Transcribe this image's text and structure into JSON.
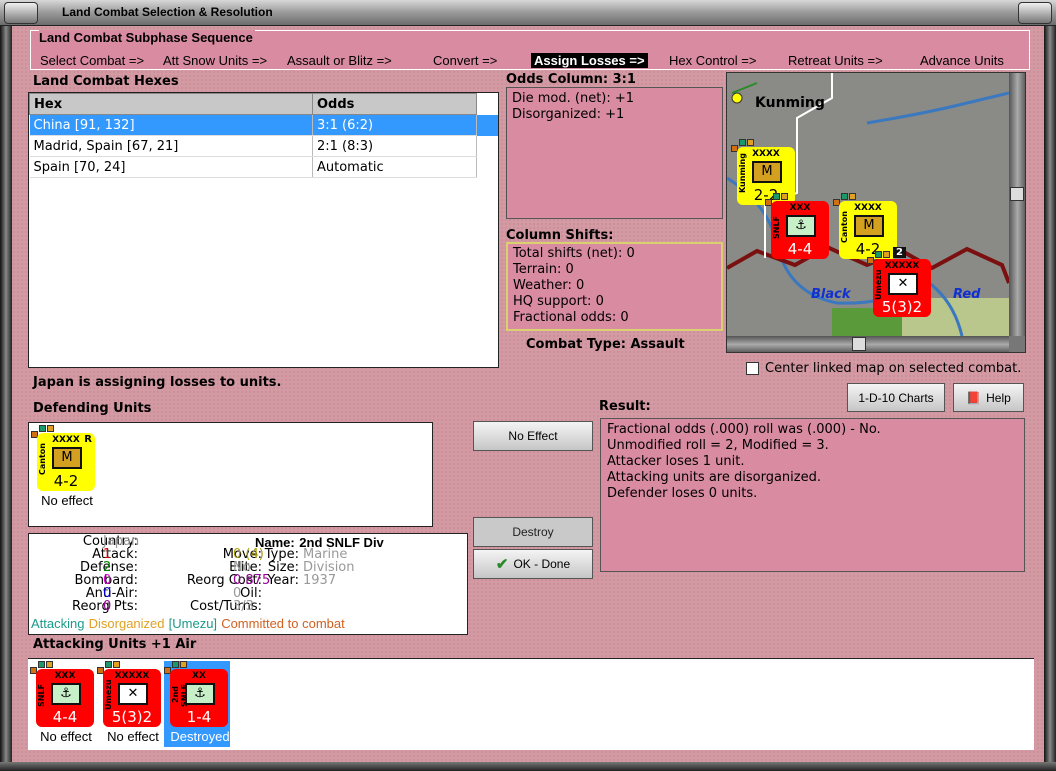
{
  "window": {
    "title": "Land Combat Selection & Resolution"
  },
  "sequence": {
    "title": "Land Combat Subphase Sequence",
    "steps": [
      "Select Combat =>",
      "Att Snow Units =>",
      "Assault or Blitz =>",
      "Convert =>",
      "Assign Losses =>",
      "Hex Control =>",
      "Retreat Units =>",
      "Advance Units"
    ],
    "active_index": 4
  },
  "hexes": {
    "title": "Land Combat Hexes",
    "columns": [
      "Hex",
      "Odds"
    ],
    "rows": [
      [
        "China [91, 132]",
        "3:1 (6:2)"
      ],
      [
        "Madrid, Spain [67, 21]",
        "2:1 (8:3)"
      ],
      [
        "Spain [70, 24]",
        "Automatic"
      ]
    ],
    "selected_index": 0
  },
  "odds": {
    "title": "Odds Column: 3:1",
    "lines": [
      "Die mod. (net): +1",
      "Disorganized: +1"
    ]
  },
  "shifts": {
    "title": "Column Shifts:",
    "lines": [
      "Total shifts (net): 0",
      "Terrain: 0",
      "Weather: 0",
      "HQ support: 0",
      "Fractional odds: 0"
    ]
  },
  "combat_type": "Combat Type:  Assault",
  "map": {
    "labels": {
      "city": "Kunming",
      "river1": "Black",
      "river2": "Red"
    },
    "units": [
      {
        "name": "Kunming",
        "size": "XXXX",
        "sym": "M",
        "str": "2-2"
      },
      {
        "name": "SNLF",
        "size": "XXX",
        "sym": "⚓",
        "str": "4-4"
      },
      {
        "name": "Canton",
        "size": "XXXX",
        "sym": "M",
        "str": "4-2"
      },
      {
        "name": "Umezu",
        "size": "XXXXX",
        "sym": "✕",
        "str": "5(3)2"
      }
    ],
    "stack_count": "2",
    "h_scroll": 0.46,
    "v_scroll": 0.45
  },
  "center_checkbox": {
    "label": "Center linked map on selected combat.",
    "checked": false
  },
  "buttons": {
    "charts": "1-D-10 Charts",
    "help": "Help",
    "no_effect": "No Effect",
    "destroy": "Destroy",
    "ok": "OK - Done"
  },
  "status": "Japan is assigning losses to units.",
  "defending": {
    "title": "Defending Units",
    "units": [
      {
        "name": "Canton",
        "size": "XXXX",
        "sym": "M",
        "str": "4-2",
        "flag": "R",
        "status": "No effect"
      }
    ]
  },
  "result": {
    "title": "Result:",
    "lines": [
      "Fractional odds (.000) roll was (.000)  - No.",
      "Unmodified roll = 2, Modified = 3.",
      "Attacker loses 1 unit.",
      "Attacking units are disorganized.",
      "Defender loses 0 units."
    ]
  },
  "info": {
    "country_l": "Country:",
    "country": "Japan",
    "attack_l": "Attack:",
    "attack": "1",
    "defense_l": "Defense:",
    "defense": "2",
    "bombard_l": "Bombard:",
    "bombard": "0",
    "aa_l": "Anti-Air:",
    "aa": "0",
    "reorgpts_l": "Reorg Pts:",
    "reorgpts": "0",
    "name_l": "Name:",
    "name": "2nd SNLF Div",
    "move_l": "Move:",
    "move": "0 (4)",
    "elite_l": "Elite:",
    "elite": "No",
    "reorgcost_l": "Reorg Cost:",
    "reorgcost": "0.875",
    "oil_l": "Oil:",
    "oil": "0",
    "cost_l": "Cost/Turns:",
    "cost": "3/3",
    "type_l": "Type:",
    "type": "Marine",
    "size_l": "Size:",
    "size": "Division",
    "year_l": "Year:",
    "year": "1937",
    "flags": [
      "Attacking",
      "Disorganized",
      "[Umezu]",
      "Committed to combat"
    ]
  },
  "attacking": {
    "title": "Attacking Units +1 Air",
    "units": [
      {
        "name": "SNLF",
        "size": "XXX",
        "sym": "⚓",
        "str": "4-4",
        "status": "No effect"
      },
      {
        "name": "Umezu",
        "size": "XXXXX",
        "sym": "✕",
        "str": "5(3)2",
        "status": "No effect"
      },
      {
        "name": "2nd SNLF Div",
        "size": "XX",
        "sym": "⚓",
        "str": "1-4",
        "status": "Destroyed",
        "selected": true
      }
    ]
  },
  "colors": {
    "axis_counter": "#ff0000",
    "allied_counter": "#ffff00",
    "pink": "#d98ba2",
    "selection": "#3399ff"
  }
}
